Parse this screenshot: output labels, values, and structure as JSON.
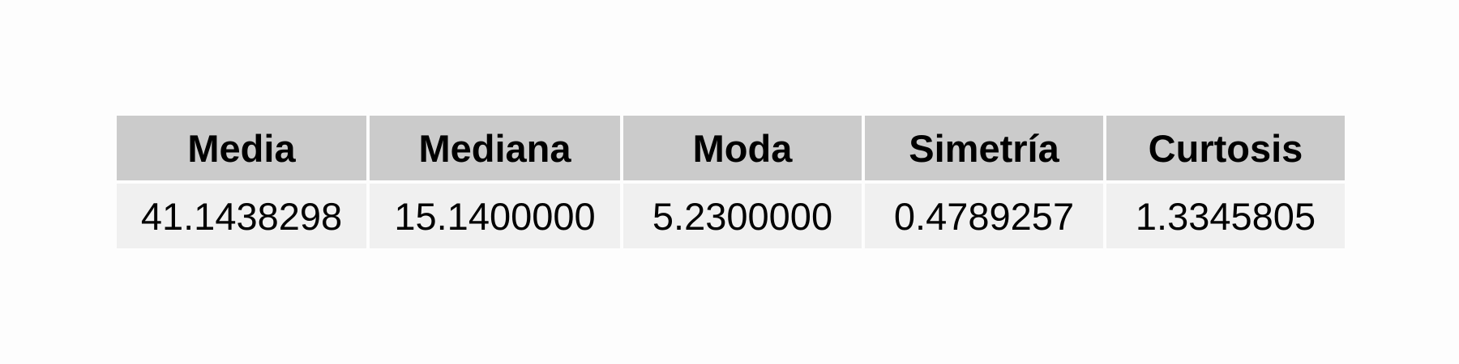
{
  "chart_data": {
    "type": "table",
    "columns": [
      "Media",
      "Mediana",
      "Moda",
      "Simetría",
      "Curtosis"
    ],
    "rows": [
      [
        "41.1438298",
        "15.1400000",
        "5.2300000",
        "0.4789257",
        "1.3345805"
      ]
    ]
  },
  "colors": {
    "header_background": "#cbcbcb",
    "cell_background": "#f0f0f0",
    "page_background": "#fdfdfd",
    "text": "#000000"
  }
}
